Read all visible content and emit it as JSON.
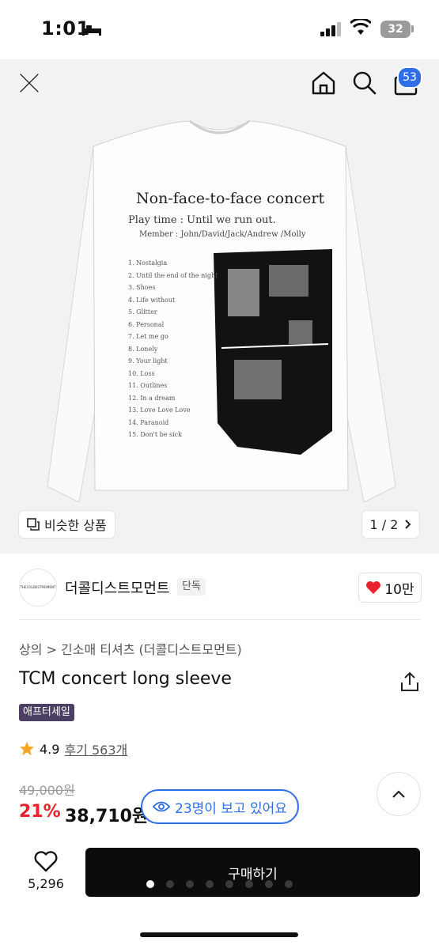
{
  "status_bar": {
    "time": "1:01",
    "battery": "32"
  },
  "header": {
    "cart_badge": "53"
  },
  "product_image": {
    "print_title": "Non-face-to-face concert",
    "print_playtime": "Play time : Until we run out.",
    "print_members": "Member : John/David/Jack/Andrew /Molly",
    "tracklist": [
      "Nostalgia",
      "Until the end of the night",
      "Shoes",
      "Life without",
      "Glitter",
      "Personal",
      "Let me go",
      "Lonely",
      "Your light",
      "Loss",
      "Outlines",
      "In a dream",
      "Love Love Love",
      "Paranoid",
      "Don't be sick"
    ],
    "similar_label": "비슷한 상품",
    "page_indicator": "1 / 2"
  },
  "brand": {
    "name": "더콜디스트모먼트",
    "tag": "단독",
    "likes": "10만",
    "logo_text": "THECOLDESTMOMENT"
  },
  "product": {
    "breadcrumb": "상의 > 긴소매 티셔츠 (더콜디스트모먼트)",
    "title": "TCM concert long sleeve",
    "sale_badge": "애프터세일",
    "rating": "4.9",
    "reviews": "후기 563개",
    "original_price": "49,000원",
    "discount": "21%",
    "price": "38,710원"
  },
  "viewers": "23명이 보고 있어요",
  "bottom_bar": {
    "wishlist_count": "5,296",
    "buy_label": "구매하기",
    "dot_count": 8,
    "active_dot": 0
  },
  "colors": {
    "accent_blue": "#2f6ee6",
    "discount_red": "#e8232d",
    "heart_red": "#e8232d",
    "sale_badge": "#4b3f63",
    "star": "#f5a623"
  },
  "icons": [
    "bed-icon",
    "signal-icon",
    "wifi-icon",
    "close-icon",
    "home-icon",
    "search-icon",
    "bag-icon",
    "copy-icon",
    "chevron-right-icon",
    "heart-icon",
    "share-icon",
    "star-icon",
    "eye-icon",
    "chevron-up-icon",
    "heart-outline-icon"
  ]
}
